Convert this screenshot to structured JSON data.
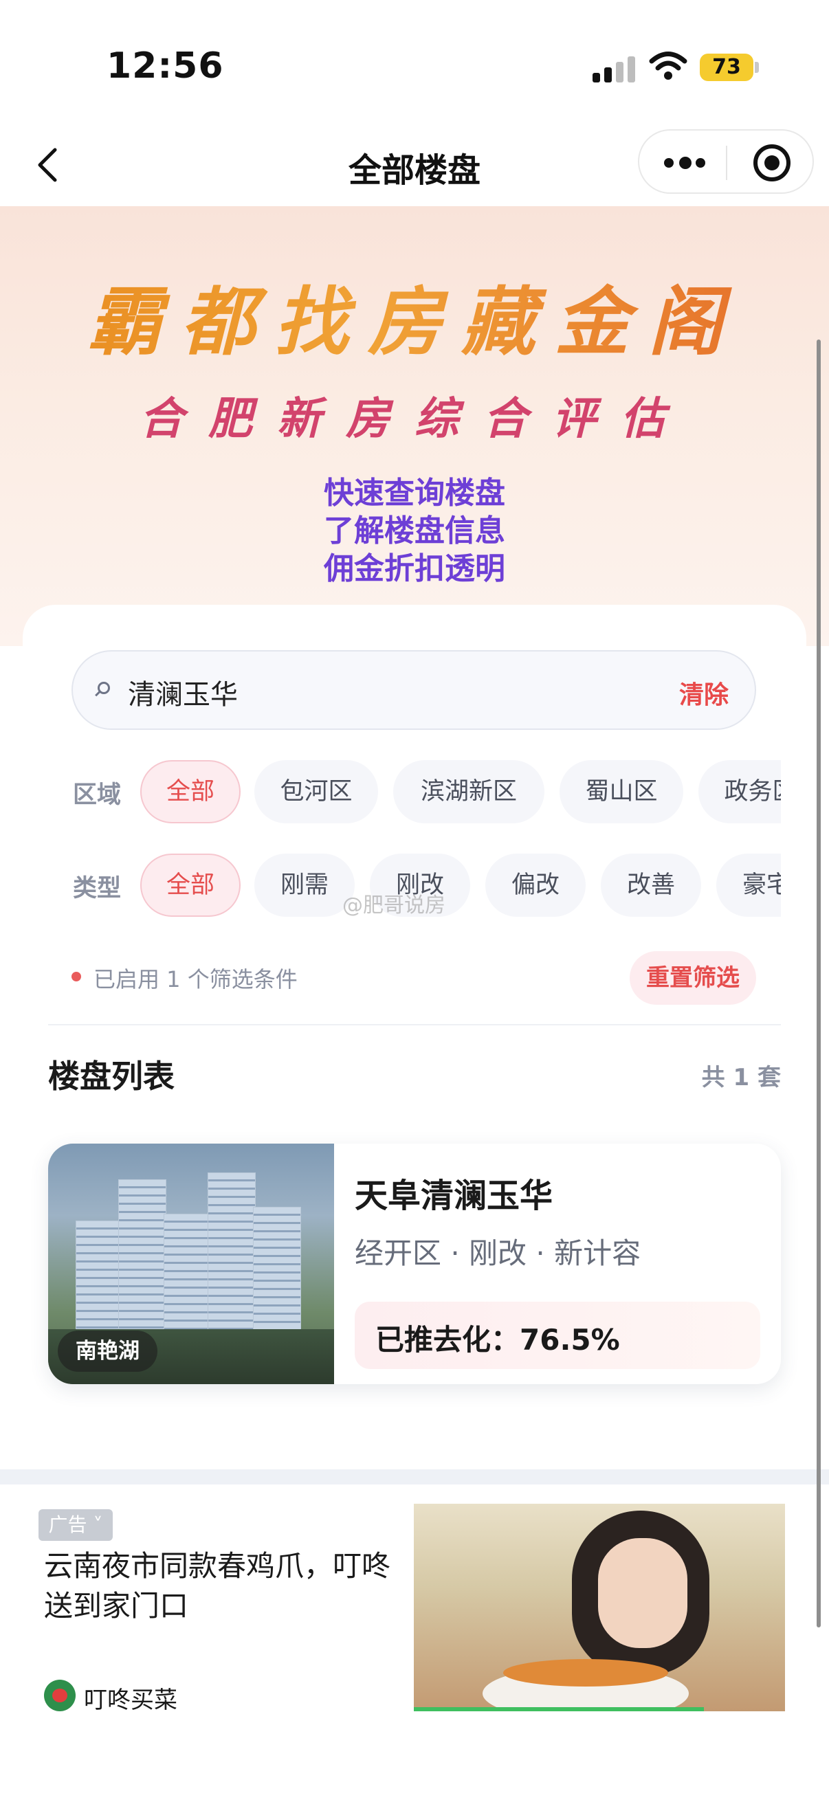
{
  "status_bar": {
    "time": "12:56",
    "battery": "73"
  },
  "nav": {
    "title": "全部楼盘"
  },
  "banner": {
    "headline": "霸都找房藏金阁",
    "subheadline": "合肥新房综合评估",
    "lines": [
      "快速查询楼盘",
      "了解楼盘信息",
      "佣金折扣透明"
    ]
  },
  "search": {
    "value": "清澜玉华",
    "clear_label": "清除"
  },
  "filters": {
    "region": {
      "label": "区域",
      "options": [
        "全部",
        "包河区",
        "滨湖新区",
        "蜀山区",
        "政务区"
      ],
      "selected": "全部"
    },
    "type": {
      "label": "类型",
      "options": [
        "全部",
        "刚需",
        "刚改",
        "偏改",
        "改善",
        "豪宅"
      ],
      "selected": "全部"
    },
    "status_text": "已启用 1 个筛选条件",
    "reset_label": "重置筛选"
  },
  "listing": {
    "title": "楼盘列表",
    "count": "共 1 套",
    "items": [
      {
        "name": "天阜清澜玉华",
        "meta": "经开区 · 刚改 · 新计容",
        "badge": "南艳湖",
        "destock": "已推去化：76.5%"
      }
    ]
  },
  "watermark": "@肥哥说房",
  "ad": {
    "tag": "广告",
    "title": "云南夜市同款春鸡爪，叮咚送到家门口",
    "brand": "叮咚买菜"
  },
  "colors": {
    "accent": "#e54d4d",
    "banner_purple": "#6d3fd6",
    "banner_pink": "#d2436c",
    "banner_orange": "#f0a236"
  }
}
